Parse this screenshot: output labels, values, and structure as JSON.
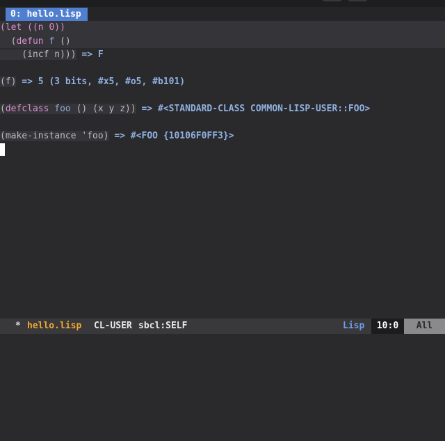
{
  "tab": {
    "label": "0: hello.lisp"
  },
  "code": {
    "l1": "(let ((n 0))",
    "l2a": "  (",
    "l2kw": "defun",
    "l2b": " ",
    "l2fn": "f",
    "l2c": " ()",
    "l3": "    (incf n)))",
    "r3": " => F",
    "l5": "(f)",
    "r5": " => 5 (3 bits, #x5, #o5, #b101)",
    "l7a": "(",
    "l7kw": "defclass",
    "l7b": " ",
    "l7fn": "foo",
    "l7c": " () (x y z))",
    "r7": " => #<STANDARD-CLASS COMMON-LISP-USER::FOO>",
    "l9": "(make-instance 'foo)",
    "r9": " => #<FOO {10106F0FF3}>"
  },
  "modeline": {
    "modified": "*",
    "buffer": "hello.lisp",
    "package": "CL-USER",
    "impl": "sbcl:SELF",
    "mode": "Lisp",
    "position": "10:0",
    "scroll": "All"
  }
}
